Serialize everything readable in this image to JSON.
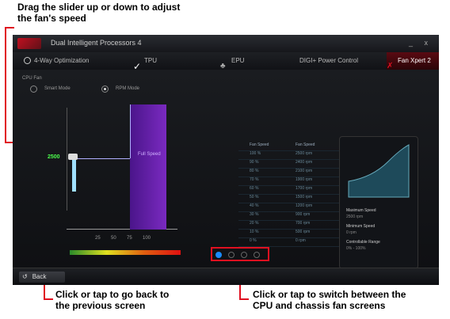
{
  "callouts": {
    "top": "Drag the slider up or down to adjust\nthe fan's speed",
    "bottom_left": "Click or tap to go back to\nthe previous screen",
    "bottom_right": "Click or tap to switch between the\nCPU and chassis fan screens"
  },
  "app": {
    "title": "Dual Intelligent Processors 4",
    "window_buttons": "_ x"
  },
  "tabs": [
    {
      "label": "4-Way Optimization",
      "active": false
    },
    {
      "label": "TPU",
      "active": false
    },
    {
      "label": "EPU",
      "active": false
    },
    {
      "label": "DIGI+ Power Control",
      "active": false
    },
    {
      "label": "Fan Xpert 2",
      "active": true
    }
  ],
  "fan": {
    "section_label": "CPU Fan",
    "mode_options": [
      {
        "label": "Smart Mode",
        "selected": false
      },
      {
        "label": "RPM Mode",
        "selected": true
      }
    ],
    "slider_value": "2500",
    "profile_label": "Full Speed",
    "x_ticks": [
      "25",
      "50",
      "75",
      "100"
    ]
  },
  "table": {
    "headers": [
      "Fan Speed",
      "Fan Speed"
    ],
    "rows": [
      [
        "100 %",
        "2500 rpm"
      ],
      [
        "90 %",
        "2400 rpm"
      ],
      [
        "80 %",
        "2100 rpm"
      ],
      [
        "70 %",
        "1900 rpm"
      ],
      [
        "60 %",
        "1700 rpm"
      ],
      [
        "50 %",
        "1500 rpm"
      ],
      [
        "40 %",
        "1200 rpm"
      ],
      [
        "30 %",
        "900 rpm"
      ],
      [
        "20 %",
        "700 rpm"
      ],
      [
        "10 %",
        "500 rpm"
      ],
      [
        "0 %",
        "0 rpm"
      ]
    ]
  },
  "card": {
    "max_label": "Maximum Speed",
    "max_value": "2500 rpm",
    "min_label": "Minimum Speed",
    "min_value": "0 rpm",
    "range_label": "Controllable Range",
    "range_value": "0% - 100%"
  },
  "pager": {
    "pages": 4,
    "active_page": 1
  },
  "bottom": {
    "back_label": "Back"
  },
  "colors": {
    "accent": "#e01020",
    "callout_line": "#e01020",
    "slider": "#a0e0ff",
    "profile": "#7a2ac0",
    "dot_active": "#1a8aff"
  }
}
